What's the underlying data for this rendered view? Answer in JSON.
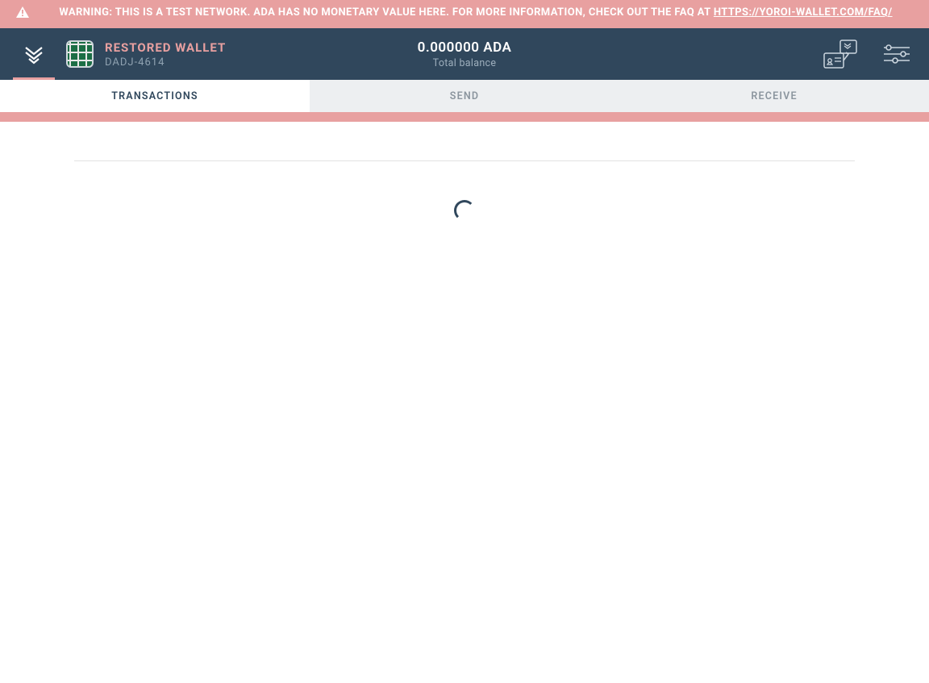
{
  "warning": {
    "prefix": "WARNING: THIS IS A TEST NETWORK. ADA HAS NO MONETARY VALUE HERE. FOR MORE INFORMATION, CHECK OUT THE FAQ AT ",
    "link_text": "HTTPS://YOROI-WALLET.COM/FAQ/"
  },
  "header": {
    "wallet_name": "RESTORED WALLET",
    "wallet_hash": "DADJ-4614",
    "balance_amount": "0.000000 ADA",
    "balance_label": "Total balance"
  },
  "tabs": {
    "transactions": "TRANSACTIONS",
    "send": "SEND",
    "receive": "RECEIVE"
  },
  "colors": {
    "banner_bg": "#E8A0A0",
    "header_bg": "#30475C",
    "accent": "#E8A0A0"
  }
}
